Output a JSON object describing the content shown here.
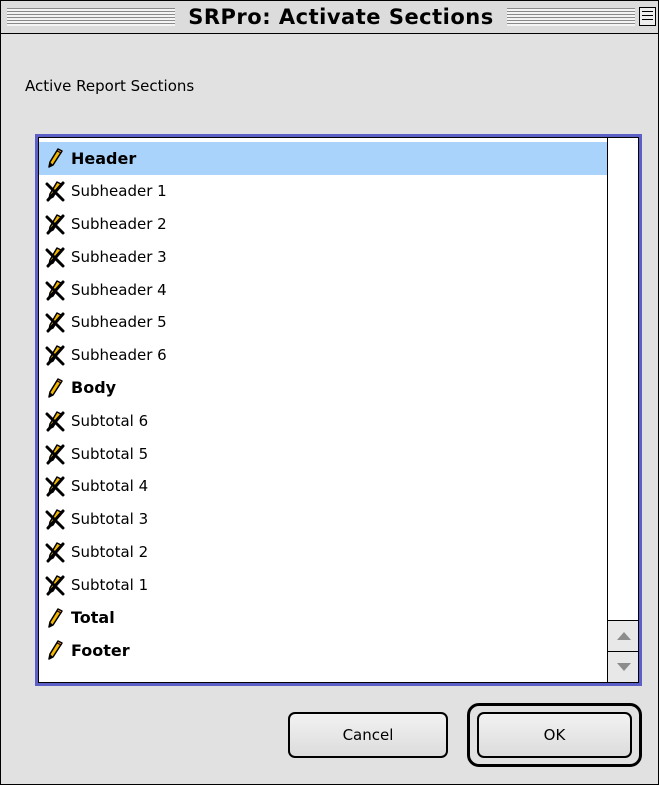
{
  "window": {
    "title": "SRPro: Activate Sections"
  },
  "section_label": "Active Report Sections",
  "sections": [
    {
      "label": "Header",
      "bold": true,
      "icon": "pencil-icon",
      "selected": true
    },
    {
      "label": "Subheader 1",
      "bold": false,
      "icon": "crossed-pencil-icon",
      "selected": false
    },
    {
      "label": "Subheader 2",
      "bold": false,
      "icon": "crossed-pencil-icon",
      "selected": false
    },
    {
      "label": "Subheader 3",
      "bold": false,
      "icon": "crossed-pencil-icon",
      "selected": false
    },
    {
      "label": "Subheader 4",
      "bold": false,
      "icon": "crossed-pencil-icon",
      "selected": false
    },
    {
      "label": "Subheader 5",
      "bold": false,
      "icon": "crossed-pencil-icon",
      "selected": false
    },
    {
      "label": "Subheader 6",
      "bold": false,
      "icon": "crossed-pencil-icon",
      "selected": false
    },
    {
      "label": "Body",
      "bold": true,
      "icon": "pencil-icon",
      "selected": false
    },
    {
      "label": "Subtotal 6",
      "bold": false,
      "icon": "crossed-pencil-icon",
      "selected": false
    },
    {
      "label": "Subtotal 5",
      "bold": false,
      "icon": "crossed-pencil-icon",
      "selected": false
    },
    {
      "label": "Subtotal 4",
      "bold": false,
      "icon": "crossed-pencil-icon",
      "selected": false
    },
    {
      "label": "Subtotal 3",
      "bold": false,
      "icon": "crossed-pencil-icon",
      "selected": false
    },
    {
      "label": "Subtotal 2",
      "bold": false,
      "icon": "crossed-pencil-icon",
      "selected": false
    },
    {
      "label": "Subtotal 1",
      "bold": false,
      "icon": "crossed-pencil-icon",
      "selected": false
    },
    {
      "label": "Total",
      "bold": true,
      "icon": "pencil-icon",
      "selected": false
    },
    {
      "label": "Footer",
      "bold": true,
      "icon": "pencil-icon",
      "selected": false
    }
  ],
  "buttons": {
    "cancel": "Cancel",
    "ok": "OK"
  },
  "colors": {
    "selection": "#a9d3fb",
    "list_focus_border": "#5b5fc6",
    "pencil": "#f5b800"
  }
}
